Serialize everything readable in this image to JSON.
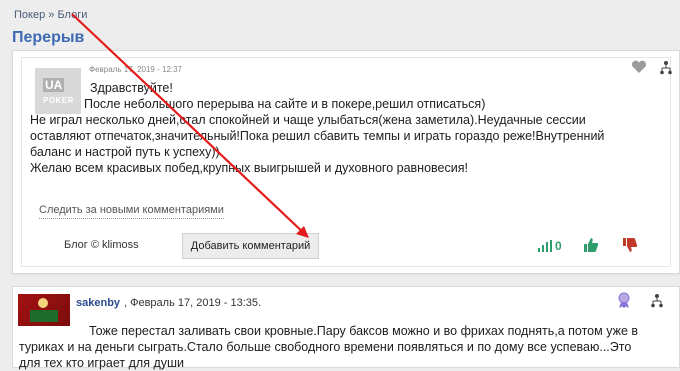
{
  "breadcrumb": {
    "item1": "Покер",
    "separator": "»",
    "item2": "Блоги"
  },
  "page_title": "Перерыв",
  "post": {
    "date": "Февраль 17, 2019 - 12:37",
    "avatar_text_ua": "UA",
    "avatar_text_poker": "POKER",
    "lines": [
      "Здравствуйте!",
      "  После небольшого перерыва на сайте и в покере,решил отписаться)",
      " Не играл несколько дней,стал спокойней и чаще улыбаться(жена заметила).Неудачные сессии",
      "оставляют отпечаток,значительный!Пока решил сбавить темпы и играть гораздо реже!Внутренний",
      "баланс и настрой путь к успеху))",
      "Желаю всем красивых побед,крупных выигрышей и духовного равновесия!"
    ],
    "follow_label": "Следить за новыми комментариями",
    "blog_by": "Блог © klimoss",
    "add_comment_label": "Добавить комментарий",
    "rating": "0",
    "icons": {
      "heart": "heart-icon",
      "tree": "tree-icon",
      "rating": "rating-icon",
      "thumb_up": "thumb-up-icon",
      "thumb_down": "thumb-down-icon"
    },
    "colors": {
      "accent": "#3f6bb5",
      "rating": "#2f9d6b",
      "thumb_down": "#c0392b"
    }
  },
  "comment": {
    "author": "sakenby",
    "date": ", Февраль 17, 2019 - 13:35.",
    "lines": [
      "Тоже перестал заливать свои кровные.Пару баксов можно и во фрихах поднять,а потом уже в",
      "туриках и на деньги сыграть.Стало больше свободного времени появляться и по дому все успеваю...Это",
      "для тех кто играет для души"
    ],
    "icons": {
      "medal": "medal-icon",
      "tree": "tree-icon"
    }
  }
}
